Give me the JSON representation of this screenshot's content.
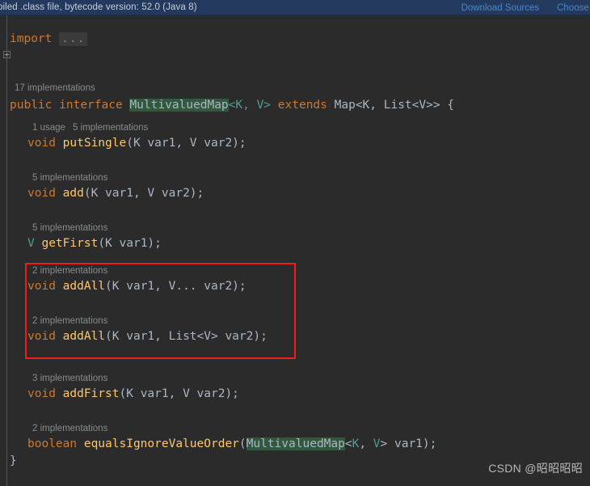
{
  "banner": {
    "message": "piled .class file, bytecode version: 52.0 (Java 8)",
    "download_sources_label": "Download Sources",
    "choose_sources_label": "Choose So",
    "bg_color": "#233a5e",
    "link_color": "#4a86c8"
  },
  "editor": {
    "background_color": "#2b2b2b",
    "default_text_color": "#a9b7c6",
    "keyword_color": "#cc7832",
    "method_color": "#ffc66d",
    "generic_color": "#4e9e92",
    "hint_color": "#868c90",
    "usage_highlight_color": "#32593d",
    "folded_placeholder": "...",
    "import_keyword": "import",
    "closing_brace": "}"
  },
  "code": {
    "class_hint": "17 implementations",
    "declaration": {
      "modifier": "public",
      "kind": "interface",
      "name": "MultivaluedMap",
      "type_params": "<K, V>",
      "extends_keyword": "extends",
      "supertype": "Map<K, List<V>> {"
    },
    "members": [
      {
        "hint_usages": "1 usage",
        "hint_impls": "5 implementations",
        "return_type": "void",
        "name": "putSingle",
        "signature": "(K var1, V var2);"
      },
      {
        "hint_usages": "",
        "hint_impls": "5 implementations",
        "return_type": "void",
        "name": "add",
        "signature": "(K var1, V var2);"
      },
      {
        "hint_usages": "",
        "hint_impls": "5 implementations",
        "return_type": "V",
        "name": "getFirst",
        "signature": "(K var1);"
      },
      {
        "hint_usages": "",
        "hint_impls": "2 implementations",
        "return_type": "void",
        "name": "addAll",
        "signature": "(K var1, V... var2);"
      },
      {
        "hint_usages": "",
        "hint_impls": "2 implementations",
        "return_type": "void",
        "name": "addAll",
        "signature": "(K var1, List<V> var2);"
      },
      {
        "hint_usages": "",
        "hint_impls": "3 implementations",
        "return_type": "void",
        "name": "addFirst",
        "signature": "(K var1, V var2);"
      },
      {
        "hint_usages": "",
        "hint_impls": "2 implementations",
        "return_type": "boolean",
        "name": "equalsIgnoreValueOrder",
        "signature": "(MultivaluedMap<K, V> var1);"
      }
    ]
  },
  "annotation": {
    "shape": "rectangle",
    "color": "#f01c1c"
  },
  "watermark": {
    "text": "CSDN @昭昭昭昭"
  }
}
